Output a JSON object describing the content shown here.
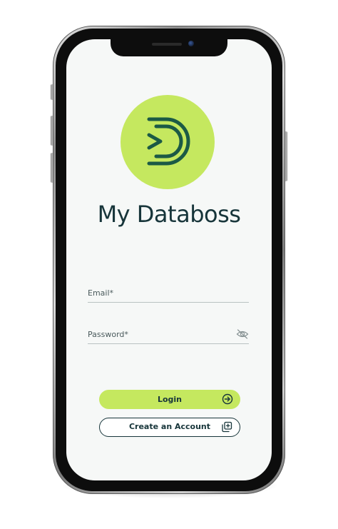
{
  "app": {
    "title": "My Databoss"
  },
  "form": {
    "email_label": "Email*",
    "password_label": "Password*"
  },
  "buttons": {
    "login_label": "Login",
    "create_account_label": "Create an Account"
  },
  "icons": {
    "logo": "databoss-logo-icon",
    "password_visibility": "eye-slash-icon",
    "login": "arrow-right-circle-icon",
    "create_account": "add-stack-icon"
  },
  "colors": {
    "accent": "#c5e85f",
    "brand_dark": "#17353a",
    "logo_stroke": "#1c5a45",
    "screen_bg": "#f6f8f7"
  }
}
